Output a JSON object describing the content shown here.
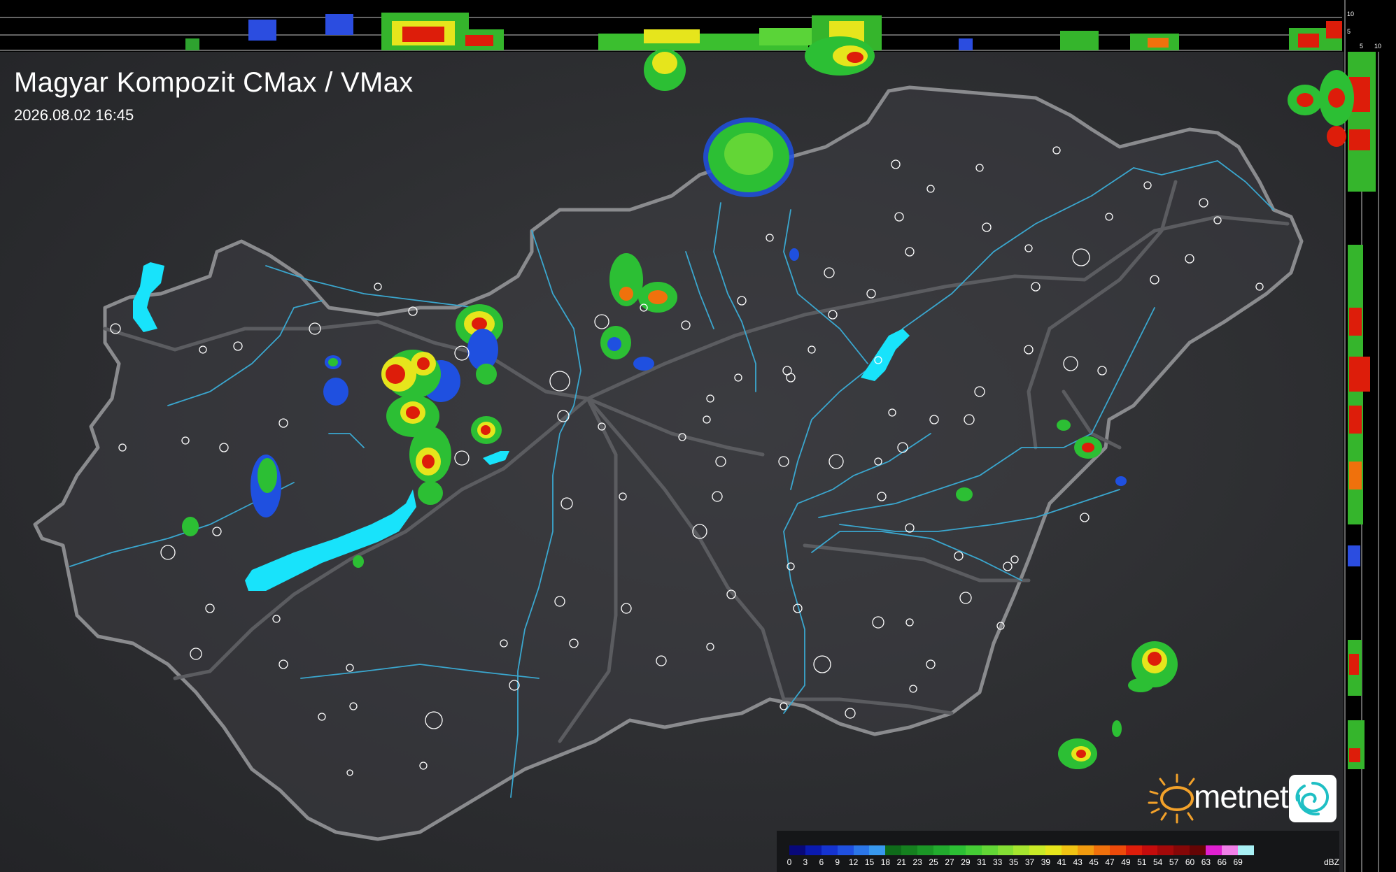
{
  "header": {
    "title": "Magyar Kompozit CMax / VMax",
    "timestamp": "2026.08.02 16:45"
  },
  "brand": {
    "name": "metnet",
    "sun_icon": "sun-icon",
    "logo_icon": "swirl-logo-icon"
  },
  "side_scale": {
    "top_labels": [
      "10",
      "5"
    ],
    "right_labels": [
      "5",
      "10"
    ]
  },
  "legend": {
    "unit": "dBZ",
    "labels": [
      "0",
      "3",
      "6",
      "9",
      "12",
      "15",
      "18",
      "21",
      "23",
      "25",
      "27",
      "29",
      "31",
      "33",
      "35",
      "37",
      "39",
      "41",
      "43",
      "45",
      "47",
      "49",
      "51",
      "54",
      "57",
      "60",
      "63",
      "66",
      "69"
    ],
    "colors": [
      "#08087a",
      "#0a1ab0",
      "#1533d0",
      "#1f50e0",
      "#2b76e8",
      "#3898ee",
      "#0f6b1a",
      "#15801f",
      "#1b9626",
      "#22ab2e",
      "#2cbf34",
      "#45cc35",
      "#63d636",
      "#84de34",
      "#a6e52f",
      "#c9ea27",
      "#e6e51c",
      "#f0c313",
      "#f19b0f",
      "#f0710c",
      "#ed4a0a",
      "#dd1d0a",
      "#c40c0c",
      "#a30909",
      "#850707",
      "#650505",
      "#e020d0",
      "#f080e8",
      "#a8f0f4"
    ]
  },
  "colors": {
    "background": "#2b2c2f",
    "border": "#8a8b8e",
    "rivers": "#3aa7cf",
    "lakes": "#18e3fb",
    "cities": "#ffffff"
  }
}
